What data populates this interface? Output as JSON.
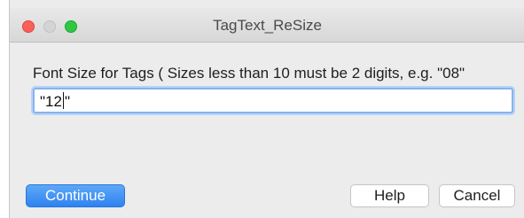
{
  "window": {
    "title": "TagText_ReSize"
  },
  "dialog": {
    "prompt": "Font Size for Tags ( Sizes less than 10 must be 2 digits, e.g. \"08\"",
    "input_value_before_caret": "\"12",
    "input_value_after_caret": "\""
  },
  "buttons": {
    "continue_label": "Continue",
    "help_label": "Help",
    "cancel_label": "Cancel"
  },
  "colors": {
    "accent": "#2f83f1",
    "close": "#fc5f57",
    "minimize_disabled": "#d4d4d4",
    "maximize": "#2fc843"
  },
  "icons": [
    "close-icon",
    "minimize-icon",
    "maximize-icon"
  ]
}
